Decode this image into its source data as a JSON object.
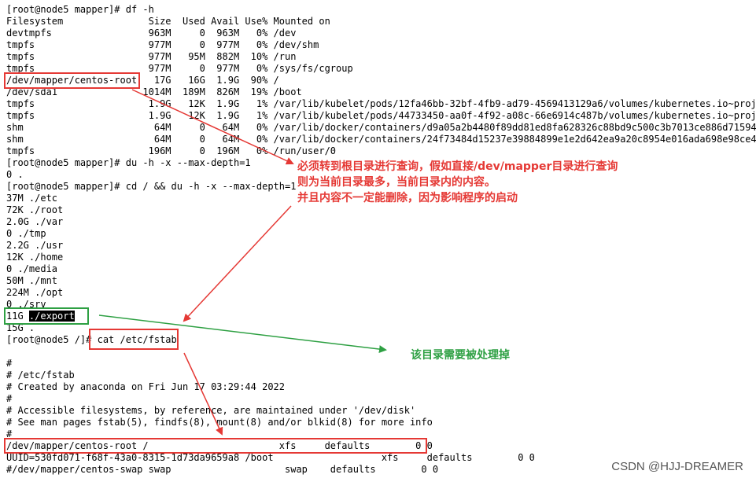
{
  "terminal": {
    "lines": [
      "[root@node5 mapper]# df -h",
      "Filesystem               Size  Used Avail Use% Mounted on",
      "devtmpfs                 963M     0  963M   0% /dev",
      "tmpfs                    977M     0  977M   0% /dev/shm",
      "tmpfs                    977M   95M  882M  10% /run",
      "tmpfs                    977M     0  977M   0% /sys/fs/cgroup",
      "/dev/mapper/centos-root   17G   16G  1.9G  90% /",
      "/dev/sda1               1014M  189M  826M  19% /boot",
      "tmpfs                    1.9G   12K  1.9G   1% /var/lib/kubelet/pods/12fa46bb-32bf-4fb9-ad79-4569413129a6/volumes/kubernetes.io~projected",
      "tmpfs                    1.9G   12K  1.9G   1% /var/lib/kubelet/pods/44733450-aa0f-4f92-a08c-66e6914c487b/volumes/kubernetes.io~projected",
      "shm                       64M     0   64M   0% /var/lib/docker/containers/d9a05a2b4480f89dd81ed8fa628326c88bd9c500c3b7013ce886d71594c398",
      "shm                       64M     0   64M   0% /var/lib/docker/containers/24f73484d15237e39884899e1e2d642ea9a20c8954e016ada698e98ce4fad4",
      "tmpfs                    196M     0  196M   0% /run/user/0",
      "[root@node5 mapper]# du -h -x --max-depth=1",
      "0 .",
      "[root@node5 mapper]# cd / && du -h -x --max-depth=1",
      "37M ./etc",
      "72K ./root",
      "2.0G ./var",
      "0 ./tmp",
      "2.2G ./usr",
      "12K ./home",
      "0 ./media",
      "50M ./mnt",
      "224M ./opt",
      "0 ./srv",
      "11G ./export",
      "15G .",
      "[root@node5 /]# cat /etc/fstab",
      "",
      "#",
      "# /etc/fstab",
      "# Created by anaconda on Fri Jun 17 03:29:44 2022",
      "#",
      "# Accessible filesystems, by reference, are maintained under '/dev/disk'",
      "# See man pages fstab(5), findfs(8), mount(8) and/or blkid(8) for more info",
      "#",
      "/dev/mapper/centos-root /                       xfs     defaults        0 0",
      "UUID=530fd071-f68f-43a0-8315-1d73da9659a8 /boot                   xfs     defaults        0 0",
      "#/dev/mapper/centos-swap swap                    swap    defaults        0 0"
    ],
    "highlight_export": "./export"
  },
  "annotations": {
    "red_note_1": "必须转到根目录进行查询，假如直接/dev/mapper目录进行查询",
    "red_note_2": "则为当前目录最多，当前目录内的内容。",
    "red_note_3": "并且内容不一定能删除，因为影响程序的启动",
    "green_note": "该目录需要被处理掉"
  },
  "watermark": "CSDN @HJJ-DREAMER",
  "colors": {
    "red": "#e53935",
    "green": "#2ea043"
  }
}
